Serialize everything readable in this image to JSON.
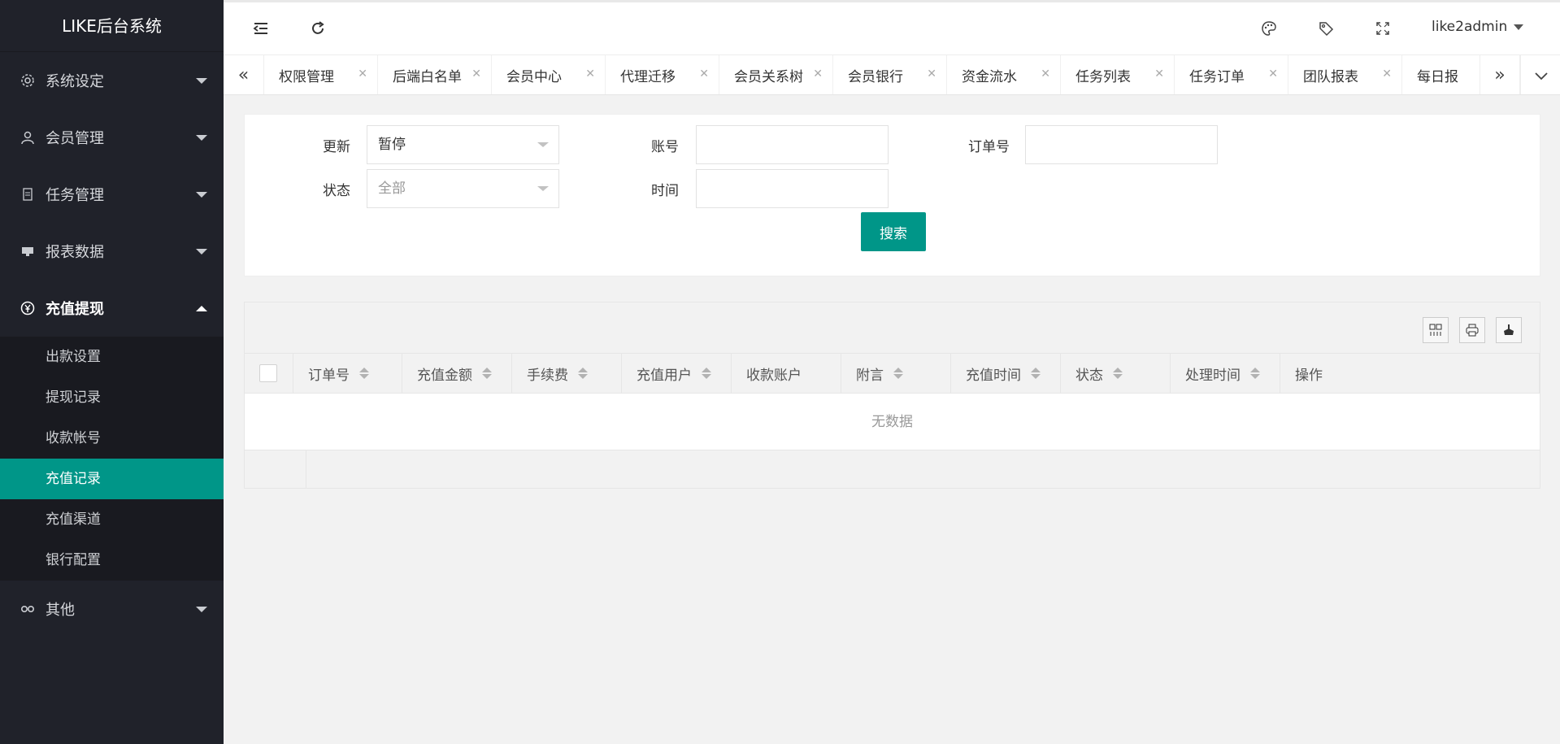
{
  "app": {
    "title": "LIKE后台系统"
  },
  "sidebar": {
    "menus": [
      {
        "label": "系统设定",
        "icon": "gear-icon"
      },
      {
        "label": "会员管理",
        "icon": "user-icon"
      },
      {
        "label": "任务管理",
        "icon": "file-icon"
      },
      {
        "label": "报表数据",
        "icon": "monitor-icon"
      },
      {
        "label": "充值提现",
        "icon": "yen-icon"
      },
      {
        "label": "其他",
        "icon": "link-icon"
      }
    ],
    "submenu": [
      {
        "label": "出款设置"
      },
      {
        "label": "提现记录"
      },
      {
        "label": "收款帐号"
      },
      {
        "label": "充值记录"
      },
      {
        "label": "充值渠道"
      },
      {
        "label": "银行配置"
      }
    ]
  },
  "header": {
    "user": "like2admin"
  },
  "tabs": [
    {
      "label": "权限管理"
    },
    {
      "label": "后端白名单"
    },
    {
      "label": "会员中心"
    },
    {
      "label": "代理迁移"
    },
    {
      "label": "会员关系树"
    },
    {
      "label": "会员银行"
    },
    {
      "label": "资金流水"
    },
    {
      "label": "任务列表"
    },
    {
      "label": "任务订单"
    },
    {
      "label": "团队报表"
    },
    {
      "label": "每日报"
    }
  ],
  "filters": {
    "update_label": "更新",
    "update_value": "暂停",
    "status_label": "状态",
    "status_value": "全部",
    "account_label": "账号",
    "time_label": "时间",
    "order_label": "订单号",
    "search_button": "搜索"
  },
  "table": {
    "columns": [
      {
        "label": "订单号"
      },
      {
        "label": "充值金额"
      },
      {
        "label": "手续费"
      },
      {
        "label": "充值用户"
      },
      {
        "label": "收款账户"
      },
      {
        "label": "附言"
      },
      {
        "label": "充值时间"
      },
      {
        "label": "状态"
      },
      {
        "label": "处理时间"
      },
      {
        "label": "操作"
      }
    ],
    "empty_text": "无数据"
  }
}
